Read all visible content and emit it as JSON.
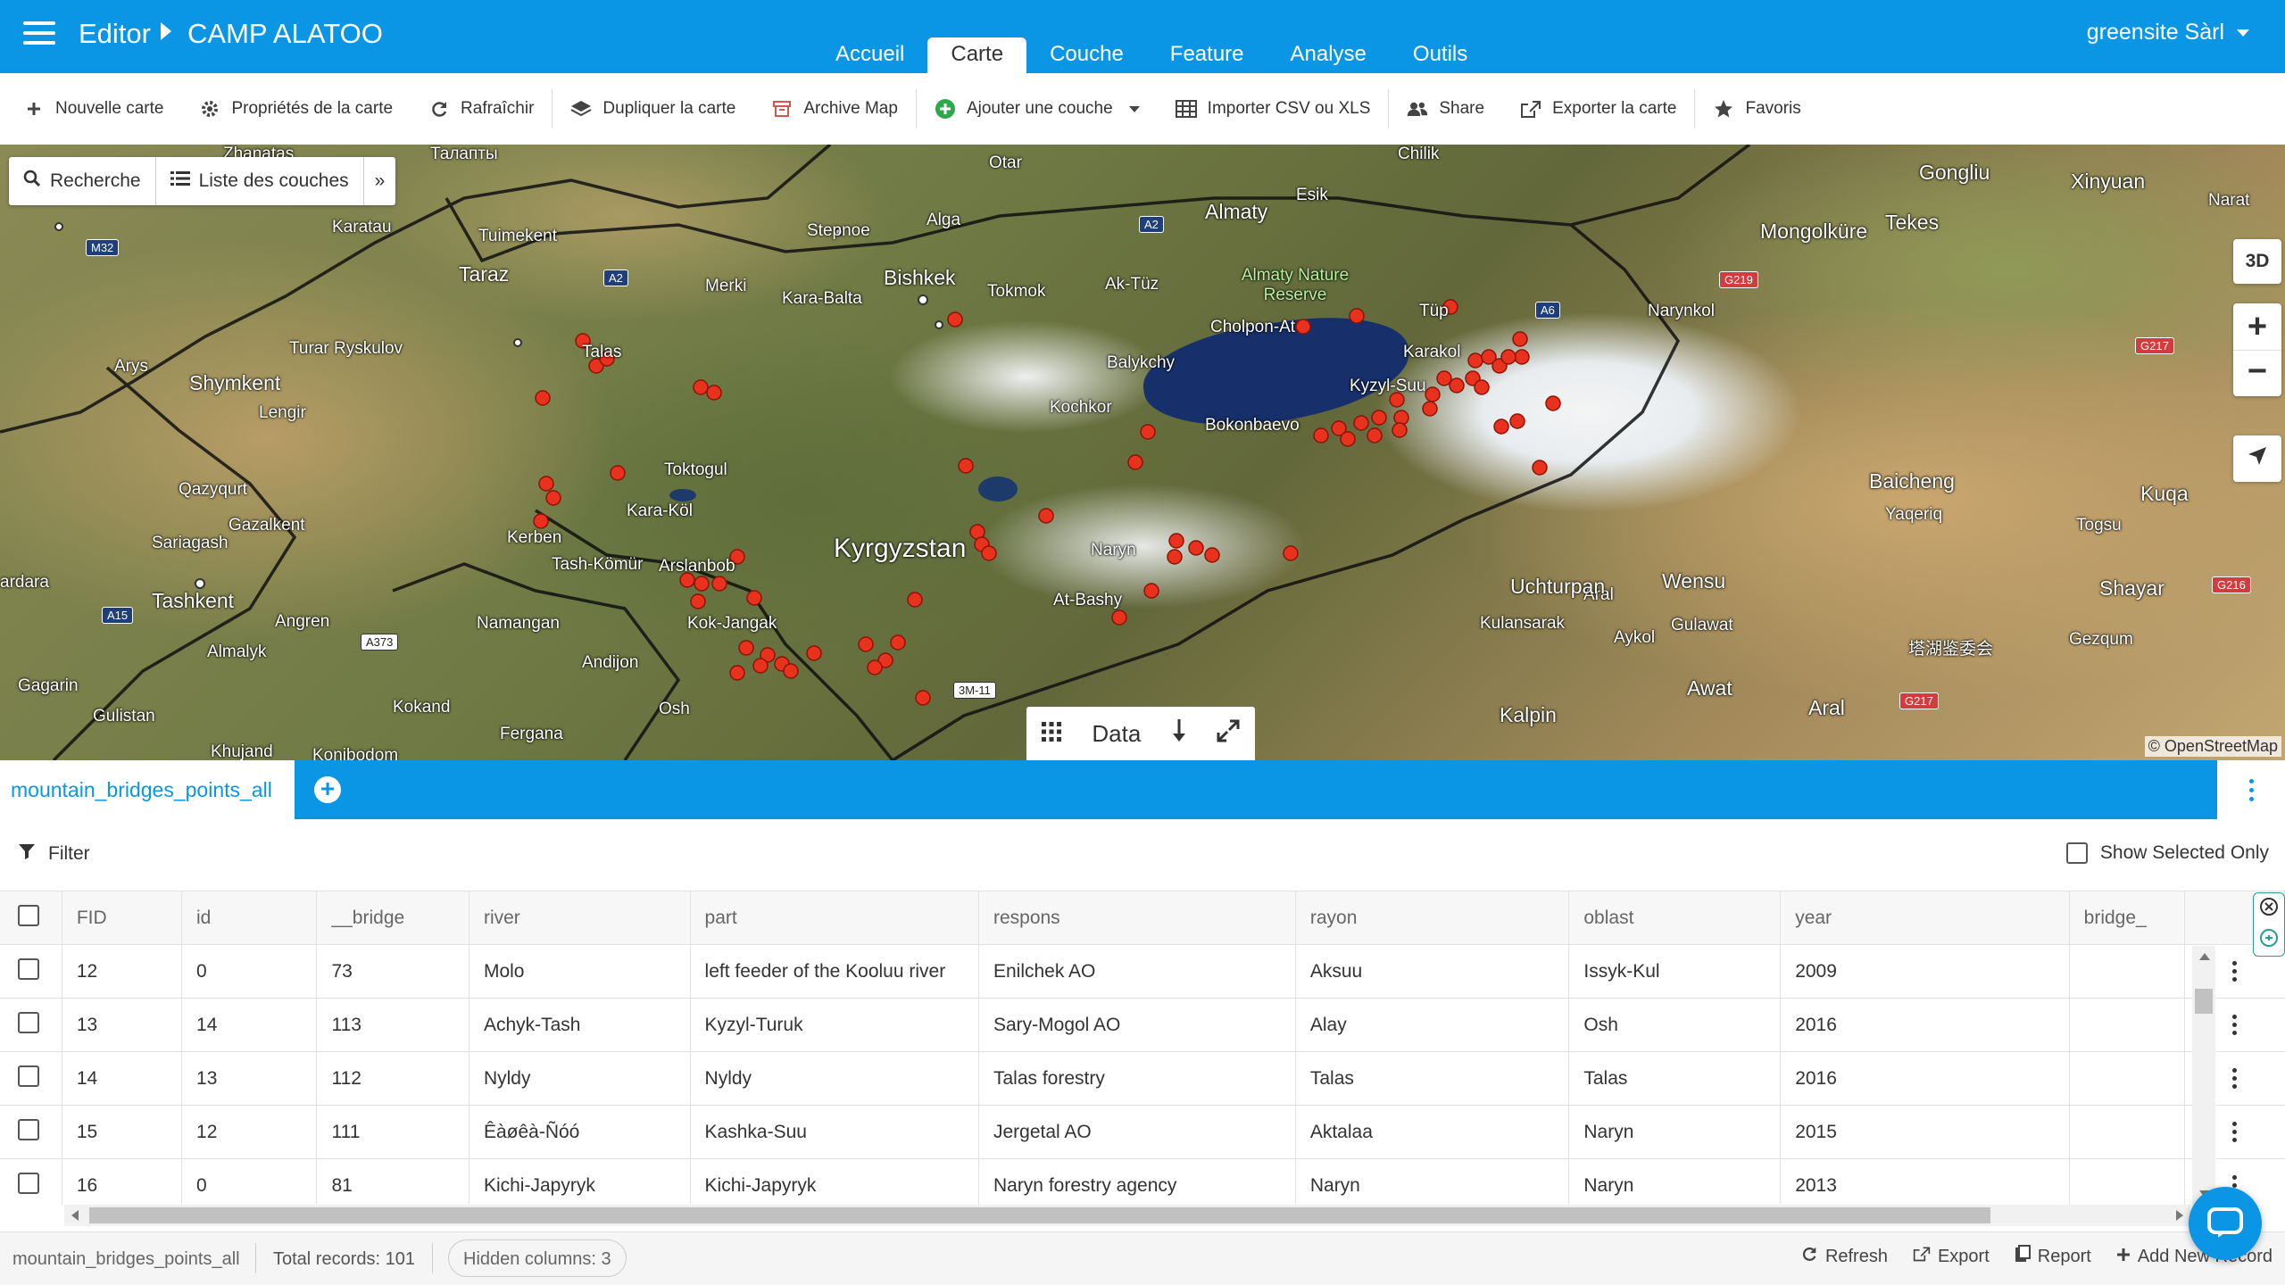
{
  "header": {
    "menu_icon": "hamburger-icon",
    "breadcrumb_root": "Editor",
    "project_name": "CAMP ALATOO",
    "tabs": [
      {
        "label": "Accueil"
      },
      {
        "label": "Carte",
        "active": true
      },
      {
        "label": "Couche"
      },
      {
        "label": "Feature"
      },
      {
        "label": "Analyse"
      },
      {
        "label": "Outils"
      }
    ],
    "account": "greensite Sàrl",
    "brand_color": "#0a96e4"
  },
  "toolbar": {
    "new_map": "Nouvelle carte",
    "map_properties": "Propriétés de la carte",
    "refresh": "Rafraîchir",
    "duplicate": "Dupliquer la carte",
    "archive": "Archive Map",
    "add_layer": "Ajouter une couche",
    "import_csv": "Importer CSV ou XLS",
    "share": "Share",
    "export_map": "Exporter la carte",
    "favorites": "Favoris"
  },
  "map": {
    "search_label": "Recherche",
    "layer_list_label": "Liste des couches",
    "more_glyph": "»",
    "btn_3d": "3D",
    "zoom_in": "+",
    "zoom_out": "−",
    "data_label": "Data",
    "attribution": "© OpenStreetMap",
    "marker_color": "#e8321e",
    "labels": {
      "kyrgyzstan": "Kyrgyzstan",
      "almaty": "Almaty",
      "bishkek": "Bishkek",
      "shymkent": "Shymkent",
      "tashkent": "Tashkent",
      "taraz": "Taraz",
      "namangan": "Namangan",
      "andijon": "Andijon",
      "osh": "Osh",
      "fergana": "Fergana",
      "kokand": "Kokand",
      "karakol": "Karakol",
      "naryn": "Naryn",
      "talas": "Talas",
      "tokmok": "Tokmok",
      "balykchy": "Balykchy",
      "cholpon_at": "Cholpon-At",
      "bokonbaevo": "Bokonbaevo",
      "kochkor": "Kochkor",
      "at_bashy": "At-Bashy",
      "kyzyl_suu": "Kyzyl-Suu",
      "kara_balta": "Kara-Balta",
      "merki": "Merki",
      "ak_tuz": "Ak-Tüz",
      "kara_kol": "Kara-Köl",
      "toktogul": "Toktogul",
      "kerben": "Kerben",
      "tash_komur": "Tash-Kömür",
      "arslanbob": "Arslanbob",
      "kok_jangak": "Kok-Jangak",
      "almalyk": "Almalyk",
      "angren": "Angren",
      "gagarin": "Gagarin",
      "gulistan": "Gulistan",
      "khujand": "Khujand",
      "konibodom": "Konibodom",
      "turar_ryskulov": "Turar Ryskulov",
      "lengir": "Lengir",
      "arys": "Arys",
      "qazyqurt": "Qazyqurt",
      "gazalkent": "Gazalkent",
      "sariaghash": "Sariagash",
      "ardara": "ardara",
      "karatau": "Karatau",
      "tuimekent": "Tuimekent",
      "stepnoe": "Stepnoe",
      "alga": "Alga",
      "otar": "Otar",
      "esik": "Esik",
      "chilik": "Chilik",
      "gongliu": "Gongliu",
      "xinyuan": "Xinyuan",
      "narat": "Narat",
      "mongolkure": "Mongolküre",
      "tekes": "Tekes",
      "narynkol": "Narynkol",
      "baicheng": "Baicheng",
      "kuqa": "Kuqa",
      "yaqeriq": "Yaqeriq",
      "togsu": "Togsu",
      "shayar": "Shayar",
      "gezqum": "Gezqum",
      "wensu": "Wensu",
      "aral": "Aral",
      "uchturpan": "Uchturpan",
      "kulansarak": "Kulansarak",
      "aykol": "Aykol",
      "gulawat": "Gulawat",
      "awat": "Awat",
      "kalpin": "Kalpin",
      "aral2": "Aral",
      "zhanatas": "Zhanatas",
      "talapty": "Талапты",
      "tup": "Tüp",
      "almaty_reserve": "Almaty Nature Reserve",
      "chinese_label": "塔湖鉴委会"
    },
    "roads": [
      "M32",
      "A2",
      "A2",
      "A6",
      "G219",
      "G217",
      "G216",
      "G217",
      "A15",
      "A373",
      "3M-11"
    ]
  },
  "layer_tab": {
    "name": "mountain_bridges_points_all",
    "add_icon": "plus-circle-icon"
  },
  "filter": {
    "label": "Filter",
    "show_selected": "Show Selected Only"
  },
  "table": {
    "columns": [
      "FID",
      "id",
      "__bridge",
      "river",
      "part",
      "respons",
      "rayon",
      "oblast",
      "year",
      "bridge_"
    ],
    "rows": [
      [
        "12",
        "0",
        "73",
        "Molo",
        "left feeder of the Kooluu river",
        "Enilchek AO",
        "Aksuu",
        "Issyk-Kul",
        "2009",
        ""
      ],
      [
        "13",
        "14",
        "113",
        "Achyk-Tash",
        "Kyzyl-Turuk",
        "Sary-Mogol AO",
        "Alay",
        "Osh",
        "2016",
        ""
      ],
      [
        "14",
        "13",
        "112",
        "Nyldy",
        "Nyldy",
        "Talas forestry",
        "Talas",
        "Talas",
        "2016",
        ""
      ],
      [
        "15",
        "12",
        "111",
        "Êàøêà-Ñóó",
        "Kashka-Suu",
        "Jergetal AO",
        "Aktalaa",
        "Naryn",
        "2015",
        ""
      ],
      [
        "16",
        "0",
        "81",
        "Kichi-Japyryk",
        "Kichi-Japyryk",
        "Naryn forestry agency",
        "Naryn",
        "Naryn",
        "2013",
        ""
      ]
    ]
  },
  "footer": {
    "layer_name": "mountain_bridges_points_all",
    "total_records": "Total records: 101",
    "hidden_columns": "Hidden columns: 3",
    "refresh": "Refresh",
    "export": "Export",
    "report": "Report",
    "add_record": "Add New Record"
  }
}
